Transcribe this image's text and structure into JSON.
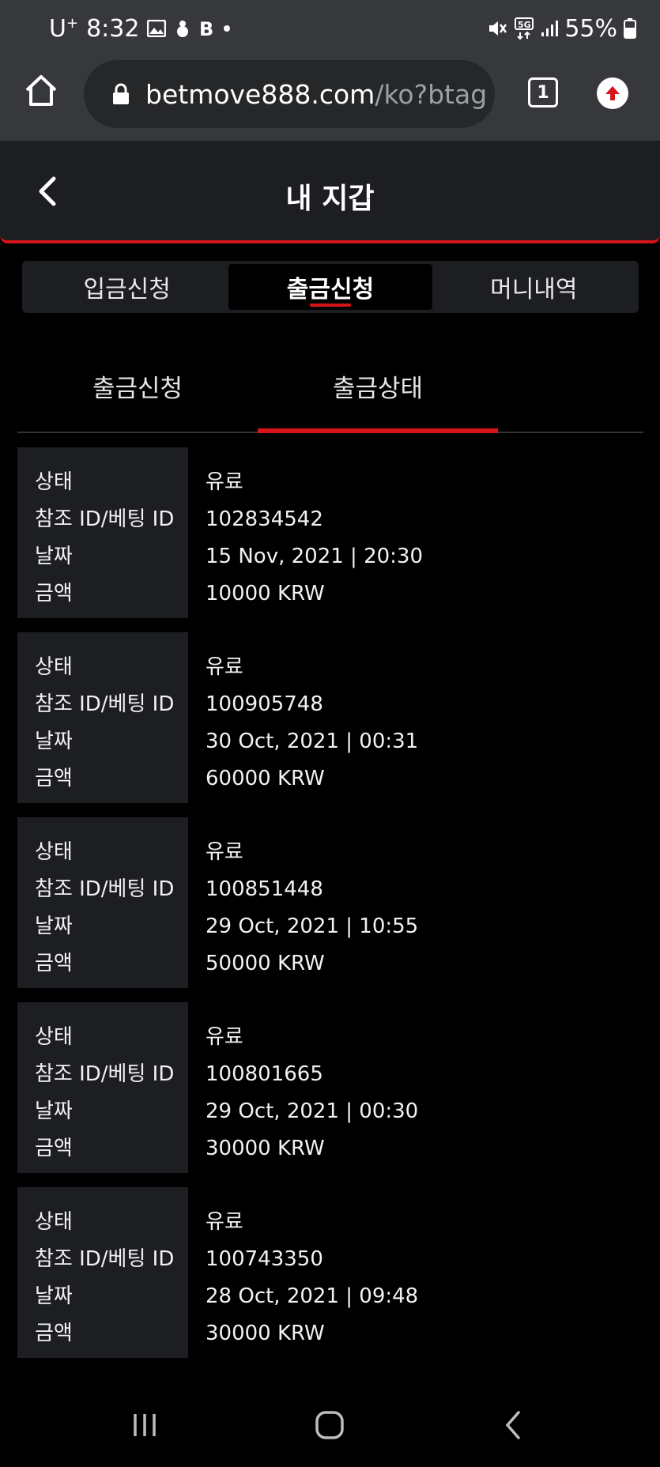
{
  "status_bar": {
    "carrier": "U",
    "carrier_sup": "+",
    "time": "8:32",
    "battery": "55%",
    "icons": [
      "image-icon",
      "bug-icon",
      "b-icon",
      "dot-icon",
      "mute-icon",
      "5g-icon",
      "signal-icon",
      "battery-icon"
    ]
  },
  "browser": {
    "url_host": "betmove888.com",
    "url_path": "/ko?btag",
    "tab_count": "1",
    "icons": [
      "home-icon",
      "lock-icon",
      "tabs-icon",
      "update-icon"
    ]
  },
  "header": {
    "title": "내 지갑",
    "back_icon": "chevron-left-icon"
  },
  "segments": {
    "items": [
      {
        "label": "입금신청"
      },
      {
        "label": "출금신청"
      },
      {
        "label": "머니내역"
      }
    ],
    "active_index": 1
  },
  "subtabs": {
    "items": [
      {
        "label": "출금신청"
      },
      {
        "label": "출금상태"
      }
    ],
    "active_index": 1
  },
  "record_labels": {
    "status": "상태",
    "ref": "참조 ID/베팅 ID",
    "date": "날짜",
    "amount": "금액"
  },
  "records": [
    {
      "status": "유료",
      "ref": "102834542",
      "date": "15 Nov, 2021 | 20:30",
      "amount": "10000 KRW"
    },
    {
      "status": "유료",
      "ref": "100905748",
      "date": "30 Oct, 2021 | 00:31",
      "amount": "60000 KRW"
    },
    {
      "status": "유료",
      "ref": "100851448",
      "date": "29 Oct, 2021 | 10:55",
      "amount": "50000 KRW"
    },
    {
      "status": "유료",
      "ref": "100801665",
      "date": "29 Oct, 2021 | 00:30",
      "amount": "30000 KRW"
    },
    {
      "status": "유료",
      "ref": "100743350",
      "date": "28 Oct, 2021 | 09:48",
      "amount": "30000 KRW"
    }
  ],
  "nav": {
    "icons": [
      "recents-icon",
      "home-circle-icon",
      "back-icon"
    ]
  },
  "colors": {
    "accent": "#d8141b",
    "chrome_bg": "#36383c",
    "panel_bg": "#1d1e22",
    "page_bg": "#000000"
  }
}
